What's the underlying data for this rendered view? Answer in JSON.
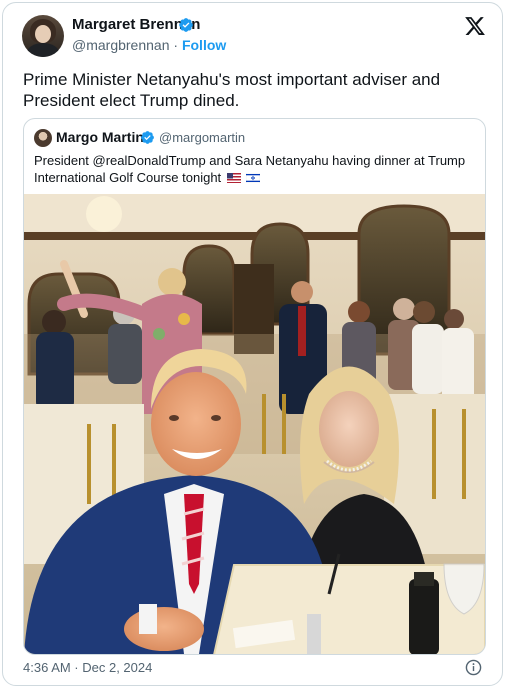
{
  "author": {
    "name": "Margaret Brennan",
    "handle": "@margbrennan",
    "separator": " · ",
    "follow_label": "Follow"
  },
  "tweet": {
    "text": "Prime Minister Netanyahu's most important adviser and President elect Trump dined.",
    "timestamp": "4:36 AM · Dec 2, 2024"
  },
  "quoted": {
    "name": "Margo Martin",
    "handle": "@margomartin",
    "text": "President @realDonaldTrump and Sara Netanyahu having dinner at Trump International Golf Course tonight"
  },
  "colors": {
    "accent": "#1d9bf0",
    "text": "#0f1419",
    "muted": "#536471",
    "border": "#cfd9de"
  },
  "icons": {
    "verified": "verified-badge-icon",
    "x_logo": "x-logo-icon",
    "info": "info-icon",
    "flags": [
      "us-flag-icon",
      "israel-flag-icon"
    ]
  }
}
